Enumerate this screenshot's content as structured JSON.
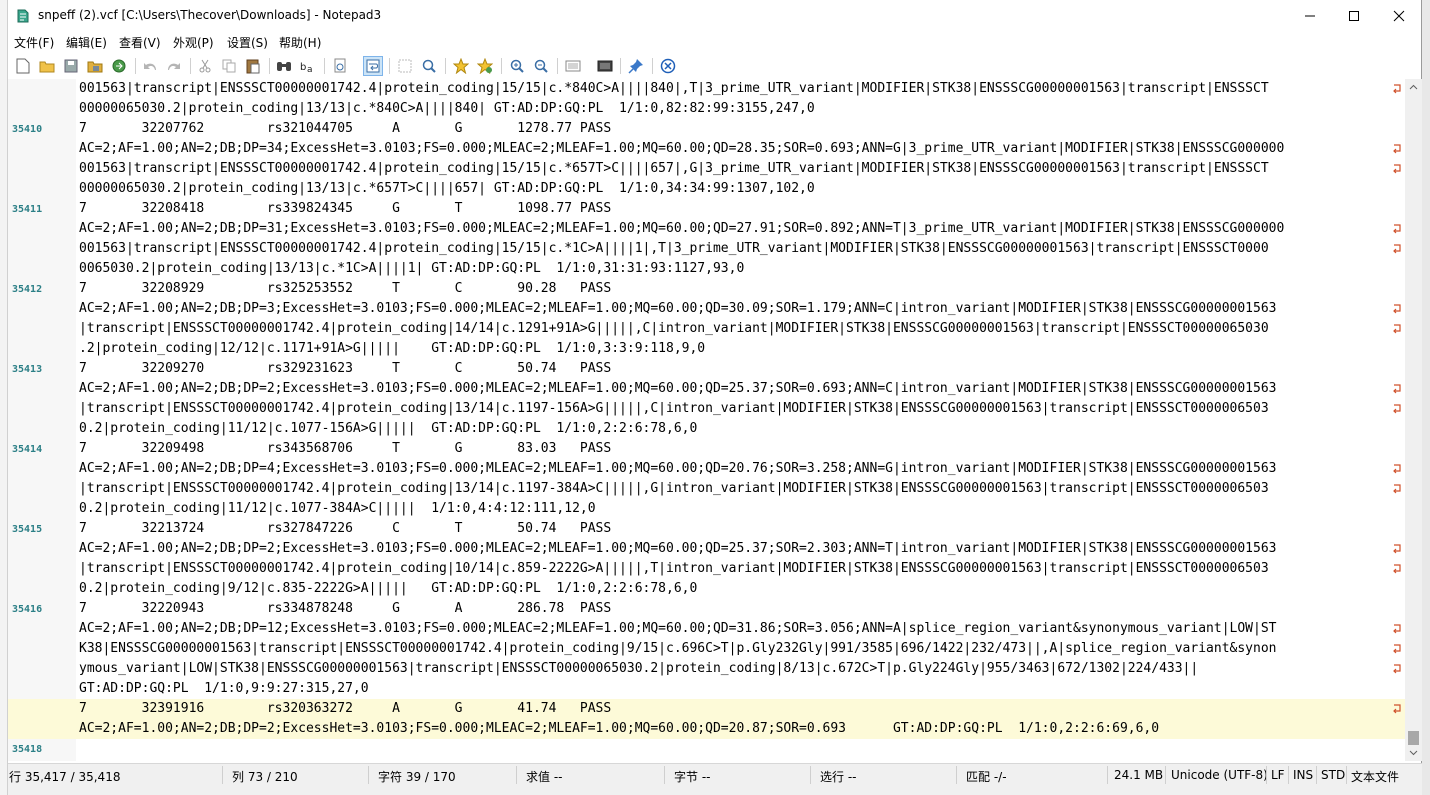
{
  "window": {
    "title": "snpeff (2).vcf [C:\\Users\\Thecover\\Downloads] - Notepad3",
    "app_icon": "notepad3-icon"
  },
  "menu": [
    "文件(F)",
    "编辑(E)",
    "查看(V)",
    "外观(P)",
    "设置(S)",
    "帮助(H)"
  ],
  "toolbar": [
    "new-file-icon",
    "open-folder-icon",
    "save-icon",
    "save-as-icon",
    "browse-icon",
    "undo-icon",
    "redo-icon",
    "cut-icon",
    "copy-icon",
    "paste-icon",
    "find-icon",
    "replace-icon",
    "goto-icon",
    "word-wrap-icon",
    "select-all-icon",
    "find-next-icon",
    "add-favorite-icon",
    "favorites-icon",
    "zoom-in-icon",
    "zoom-out-icon",
    "schemes-icon",
    "customize-icon",
    "pin-icon",
    "exit-icon"
  ],
  "editor": {
    "accent": "#2b7f86",
    "current_line_bg": "#fdfad8",
    "lines": [
      {
        "n": "",
        "text": "001563|transcript|ENSSSCT00000001742.4|protein_coding|15/15|c.*840C>A||||840|,T|3_prime_UTR_variant|MODIFIER|STK38|ENSSSCG00000001563|transcript|ENSSSCT"
      },
      {
        "n": "",
        "text": "00000065030.2|protein_coding|13/13|c.*840C>A||||840| GT:AD:DP:GQ:PL  1/1:0,82:82:99:3155,247,0"
      },
      {
        "n": "35410",
        "text": "7       32207762        rs321044705     A       G       1278.77 PASS"
      },
      {
        "n": "",
        "text": "AC=2;AF=1.00;AN=2;DB;DP=34;ExcessHet=3.0103;FS=0.000;MLEAC=2;MLEAF=1.00;MQ=60.00;QD=28.35;SOR=0.693;ANN=G|3_prime_UTR_variant|MODIFIER|STK38|ENSSSCG000000"
      },
      {
        "n": "",
        "text": "001563|transcript|ENSSSCT00000001742.4|protein_coding|15/15|c.*657T>C||||657|,G|3_prime_UTR_variant|MODIFIER|STK38|ENSSSCG00000001563|transcript|ENSSSCT"
      },
      {
        "n": "",
        "text": "00000065030.2|protein_coding|13/13|c.*657T>C||||657| GT:AD:DP:GQ:PL  1/1:0,34:34:99:1307,102,0"
      },
      {
        "n": "35411",
        "text": "7       32208418        rs339824345     G       T       1098.77 PASS"
      },
      {
        "n": "",
        "text": "AC=2;AF=1.00;AN=2;DB;DP=31;ExcessHet=3.0103;FS=0.000;MLEAC=2;MLEAF=1.00;MQ=60.00;QD=27.91;SOR=0.892;ANN=T|3_prime_UTR_variant|MODIFIER|STK38|ENSSSCG000000"
      },
      {
        "n": "",
        "text": "001563|transcript|ENSSSCT00000001742.4|protein_coding|15/15|c.*1C>A||||1|,T|3_prime_UTR_variant|MODIFIER|STK38|ENSSSCG00000001563|transcript|ENSSSCT0000"
      },
      {
        "n": "",
        "text": "0065030.2|protein_coding|13/13|c.*1C>A||||1| GT:AD:DP:GQ:PL  1/1:0,31:31:93:1127,93,0"
      },
      {
        "n": "35412",
        "text": "7       32208929        rs325253552     T       C       90.28   PASS"
      },
      {
        "n": "",
        "text": "AC=2;AF=1.00;AN=2;DB;DP=3;ExcessHet=3.0103;FS=0.000;MLEAC=2;MLEAF=1.00;MQ=60.00;QD=30.09;SOR=1.179;ANN=C|intron_variant|MODIFIER|STK38|ENSSSCG00000001563"
      },
      {
        "n": "",
        "text": "|transcript|ENSSSCT00000001742.4|protein_coding|14/14|c.1291+91A>G|||||,C|intron_variant|MODIFIER|STK38|ENSSSCG00000001563|transcript|ENSSSCT00000065030"
      },
      {
        "n": "",
        "text": ".2|protein_coding|12/12|c.1171+91A>G|||||    GT:AD:DP:GQ:PL  1/1:0,3:3:9:118,9,0"
      },
      {
        "n": "35413",
        "text": "7       32209270        rs329231623     T       C       50.74   PASS"
      },
      {
        "n": "",
        "text": "AC=2;AF=1.00;AN=2;DB;DP=2;ExcessHet=3.0103;FS=0.000;MLEAC=2;MLEAF=1.00;MQ=60.00;QD=25.37;SOR=0.693;ANN=C|intron_variant|MODIFIER|STK38|ENSSSCG00000001563"
      },
      {
        "n": "",
        "text": "|transcript|ENSSSCT00000001742.4|protein_coding|13/14|c.1197-156A>G|||||,C|intron_variant|MODIFIER|STK38|ENSSSCG00000001563|transcript|ENSSSCT0000006503"
      },
      {
        "n": "",
        "text": "0.2|protein_coding|11/12|c.1077-156A>G|||||  GT:AD:DP:GQ:PL  1/1:0,2:2:6:78,6,0"
      },
      {
        "n": "35414",
        "text": "7       32209498        rs343568706     T       G       83.03   PASS"
      },
      {
        "n": "",
        "text": "AC=2;AF=1.00;AN=2;DB;DP=4;ExcessHet=3.0103;FS=0.000;MLEAC=2;MLEAF=1.00;MQ=60.00;QD=20.76;SOR=3.258;ANN=G|intron_variant|MODIFIER|STK38|ENSSSCG00000001563"
      },
      {
        "n": "",
        "text": "|transcript|ENSSSCT00000001742.4|protein_coding|13/14|c.1197-384A>C|||||,G|intron_variant|MODIFIER|STK38|ENSSSCG00000001563|transcript|ENSSSCT0000006503"
      },
      {
        "n": "",
        "text": "0.2|protein_coding|11/12|c.1077-384A>C|||||  1/1:0,4:4:12:111,12,0"
      },
      {
        "n": "35415",
        "text": "7       32213724        rs327847226     C       T       50.74   PASS"
      },
      {
        "n": "",
        "text": "AC=2;AF=1.00;AN=2;DB;DP=2;ExcessHet=3.0103;FS=0.000;MLEAC=2;MLEAF=1.00;MQ=60.00;QD=25.37;SOR=2.303;ANN=T|intron_variant|MODIFIER|STK38|ENSSSCG00000001563"
      },
      {
        "n": "",
        "text": "|transcript|ENSSSCT00000001742.4|protein_coding|10/14|c.859-2222G>A|||||,T|intron_variant|MODIFIER|STK38|ENSSSCG00000001563|transcript|ENSSSCT0000006503"
      },
      {
        "n": "",
        "text": "0.2|protein_coding|9/12|c.835-2222G>A|||||   GT:AD:DP:GQ:PL  1/1:0,2:2:6:78,6,0"
      },
      {
        "n": "35416",
        "text": "7       32220943        rs334878248     G       A       286.78  PASS"
      },
      {
        "n": "",
        "text": "AC=2;AF=1.00;AN=2;DB;DP=12;ExcessHet=3.0103;FS=0.000;MLEAC=2;MLEAF=1.00;MQ=60.00;QD=31.86;SOR=3.056;ANN=A|splice_region_variant&synonymous_variant|LOW|ST"
      },
      {
        "n": "",
        "text": "K38|ENSSSCG00000001563|transcript|ENSSSCT00000001742.4|protein_coding|9/15|c.696C>T|p.Gly232Gly|991/3585|696/1422|232/473||,A|splice_region_variant&synon"
      },
      {
        "n": "",
        "text": "ymous_variant|LOW|STK38|ENSSSCG00000001563|transcript|ENSSSCT00000065030.2|protein_coding|8/13|c.672C>T|p.Gly224Gly|955/3463|672/1302|224/433||"
      },
      {
        "n": "",
        "text": "GT:AD:DP:GQ:PL  1/1:0,9:9:27:315,27,0"
      },
      {
        "n": "35417",
        "text": "7       32391916        rs320363272     A       G       41.74   PASS"
      },
      {
        "n": "",
        "text": "AC=2;AF=1.00;AN=2;DB;DP=2;ExcessHet=3.0103;FS=0.000;MLEAC=2;MLEAF=1.00;MQ=60.00;QD=20.87;SOR=0.693      GT:AD:DP:GQ:PL  1/1:0,2:2:6:69,6,0"
      },
      {
        "n": "35418",
        "text": ""
      }
    ],
    "wrapped_rows": [
      0,
      3,
      4,
      7,
      8,
      11,
      12,
      15,
      16,
      19,
      20,
      23,
      24,
      27,
      28,
      29,
      31
    ]
  },
  "statusbar": {
    "line_label": "行 35,417 / 35,418",
    "col_label": "列  73 / 210",
    "char_label": "字符  39 / 170",
    "eval_label": "求值  --",
    "bytes_label": "字节  --",
    "sel_label": "选行  --",
    "match_label": "匹配  -/-",
    "size": "24.1 MB",
    "encoding": "Unicode (UTF-8)",
    "eol": "LF",
    "ins": "INS",
    "std": "STD",
    "type": "文本文件"
  }
}
